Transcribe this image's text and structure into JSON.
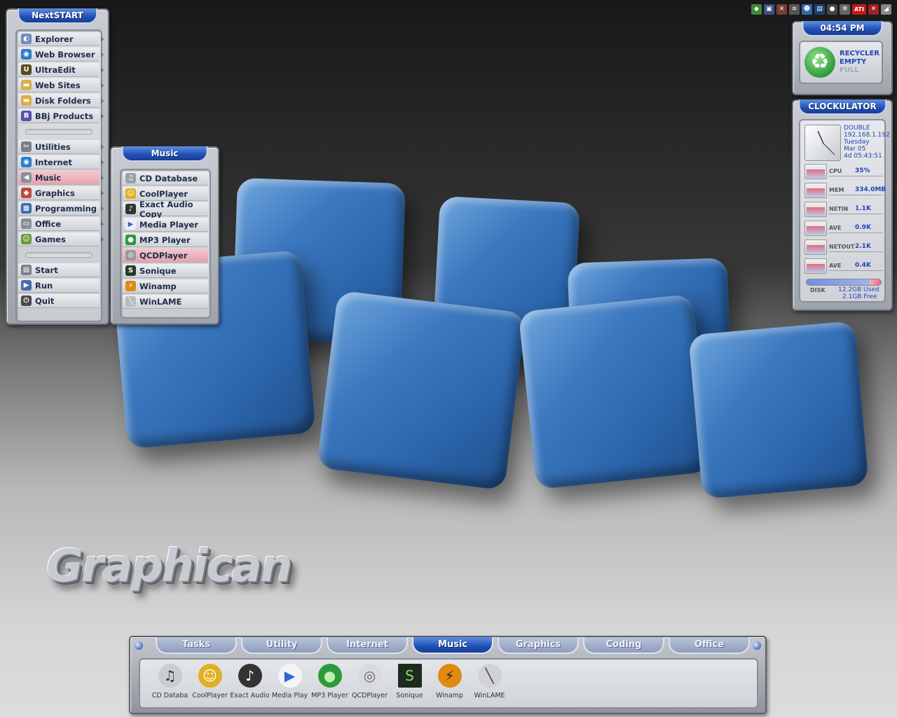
{
  "wallpaper": {
    "logo_text": "Graphican"
  },
  "colors": {
    "accent_blue": "#1f4fb6",
    "active_item": "#e7a3ac",
    "panel_silver": "#c9ccd2",
    "cube_blue": "#3c78bf"
  },
  "tray": {
    "icons": [
      "network-icon",
      "monitor-icon",
      "shield-icon",
      "wifi-icon",
      "user-icon",
      "window-icon",
      "gear-icon",
      "settings-icon",
      "ati-icon",
      "close-icon",
      "minimize-icon"
    ],
    "ati_label": "ATI"
  },
  "nextstart": {
    "title": "NextSTART",
    "items_top": [
      {
        "label": "Explorer",
        "icon": "explorer-icon"
      },
      {
        "label": "Web Browser",
        "icon": "globe-icon"
      },
      {
        "label": "UltraEdit",
        "icon": "ultraedit-icon"
      },
      {
        "label": "Web Sites",
        "icon": "folder-icon"
      },
      {
        "label": "Disk Folders",
        "icon": "folder-icon"
      },
      {
        "label": "BBj Products",
        "icon": "bbj-icon"
      }
    ],
    "items_mid": [
      {
        "label": "Utilities",
        "icon": "tools-icon"
      },
      {
        "label": "Internet",
        "icon": "globe-icon"
      },
      {
        "label": "Music",
        "icon": "speaker-icon"
      },
      {
        "label": "Graphics",
        "icon": "graphics-icon"
      },
      {
        "label": "Programming",
        "icon": "programming-icon"
      },
      {
        "label": "Office",
        "icon": "office-icon"
      },
      {
        "label": "Games",
        "icon": "games-icon"
      }
    ],
    "items_bottom": [
      {
        "label": "Start",
        "icon": "start-icon"
      },
      {
        "label": "Run",
        "icon": "run-icon"
      },
      {
        "label": "Quit",
        "icon": "quit-icon"
      }
    ]
  },
  "music_menu": {
    "title": "Music",
    "items": [
      {
        "label": "CD Database",
        "icon": "cd-icon"
      },
      {
        "label": "CoolPlayer",
        "icon": "coolplayer-icon"
      },
      {
        "label": "Exact Audio Copy",
        "icon": "eac-icon"
      },
      {
        "label": "Media Player",
        "icon": "mediaplayer-icon"
      },
      {
        "label": "MP3 Player",
        "icon": "mp3-icon"
      },
      {
        "label": "QCDPlayer",
        "icon": "qcd-icon"
      },
      {
        "label": "Sonique",
        "icon": "sonique-icon"
      },
      {
        "label": "Winamp",
        "icon": "winamp-icon"
      },
      {
        "label": "WinLAME",
        "icon": "winlame-icon"
      }
    ]
  },
  "clock": {
    "time": "04:54 PM"
  },
  "recycler": {
    "line1": "RECYCLER",
    "line2": "EMPTY",
    "line3": "FULL"
  },
  "clockulator": {
    "title": "CLOCKULATOR",
    "host": "DOUBLE",
    "ip": "192.168.1.192",
    "day": "Tuesday",
    "date": "Mar 05",
    "uptime": "4d 05:43:51",
    "meters": [
      {
        "label": "CPU",
        "value": "35%"
      },
      {
        "label": "MEM",
        "value": "334.0MB"
      },
      {
        "label": "NETIN",
        "value": "1.1K"
      },
      {
        "label": "AVE",
        "value": "0.9K"
      },
      {
        "label": "NETOUT",
        "value": "2.1K"
      },
      {
        "label": "AVE",
        "value": "0.4K"
      }
    ],
    "disk_label": "DISK",
    "disk_used": "12.2GB Used",
    "disk_free": "2.1GB Free"
  },
  "dock": {
    "tabs": [
      "Tasks",
      "Utility",
      "Internet",
      "Music",
      "Graphics",
      "Coding",
      "Office"
    ],
    "active_tab": "Music",
    "items": [
      "CD Databa",
      "CoolPlayer",
      "Exact Audio",
      "Media Play",
      "MP3 Player",
      "QCDPlayer",
      "Sonique",
      "Winamp",
      "WinLAME"
    ]
  }
}
